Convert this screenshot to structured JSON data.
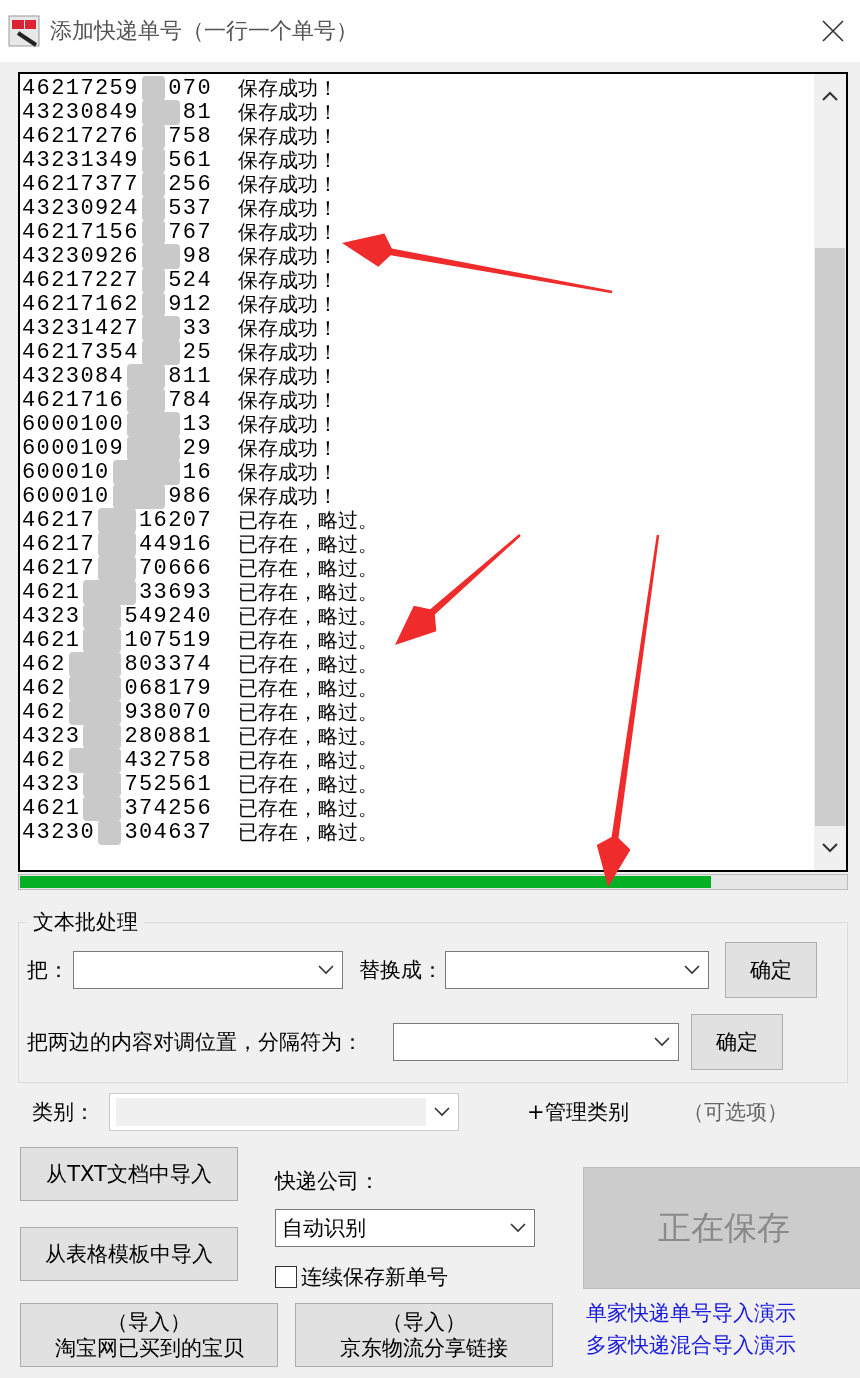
{
  "window": {
    "title": "添加快递单号（一行一个单号）"
  },
  "log": {
    "rows": [
      {
        "head": "46217259",
        "tail": "070",
        "status": "保存成功！"
      },
      {
        "head": "43230849",
        "tail": "81",
        "status": "保存成功！"
      },
      {
        "head": "46217276",
        "tail": "758",
        "status": "保存成功！"
      },
      {
        "head": "43231349",
        "tail": "561",
        "status": "保存成功！"
      },
      {
        "head": "46217377",
        "tail": "256",
        "status": "保存成功！"
      },
      {
        "head": "43230924",
        "tail": "537",
        "status": "保存成功！"
      },
      {
        "head": "46217156",
        "tail": "767",
        "status": "保存成功！"
      },
      {
        "head": "43230926",
        "tail": "98",
        "status": "保存成功！"
      },
      {
        "head": "46217227",
        "tail": "524",
        "status": "保存成功！"
      },
      {
        "head": "46217162",
        "tail": "912",
        "status": "保存成功！"
      },
      {
        "head": "43231427",
        "tail": "33",
        "status": "保存成功！"
      },
      {
        "head": "46217354",
        "tail": "25",
        "status": "保存成功！"
      },
      {
        "head": "4323084",
        "tail": "811",
        "status": "保存成功！"
      },
      {
        "head": "4621716",
        "tail": "784",
        "status": "保存成功！"
      },
      {
        "head": "6000100",
        "tail": "13",
        "status": "保存成功！"
      },
      {
        "head": "6000109",
        "tail": "29",
        "status": "保存成功！"
      },
      {
        "head": "600010",
        "tail": "16",
        "status": "保存成功！"
      },
      {
        "head": "600010",
        "tail": "986",
        "status": "保存成功！"
      },
      {
        "head": "46217",
        "tail": "16207",
        "status": "已存在，略过。"
      },
      {
        "head": "46217",
        "tail": "44916",
        "status": "已存在，略过。"
      },
      {
        "head": "46217",
        "tail": "70666",
        "status": "已存在，略过。"
      },
      {
        "head": "4621",
        "tail": "33693",
        "status": "已存在，略过。"
      },
      {
        "head": "4323",
        "tail": "549240",
        "status": "已存在，略过。"
      },
      {
        "head": "4621",
        "tail": "107519",
        "status": "已存在，略过。"
      },
      {
        "head": "462",
        "tail": "803374",
        "status": "已存在，略过。"
      },
      {
        "head": "462",
        "tail": "068179",
        "status": "已存在，略过。"
      },
      {
        "head": "462",
        "tail": "938070",
        "status": "已存在，略过。"
      },
      {
        "head": "4323",
        "tail": "280881",
        "status": "已存在，略过。"
      },
      {
        "head": "462",
        "tail": "432758",
        "status": "已存在，略过。"
      },
      {
        "head": "4323",
        "tail": "752561",
        "status": "已存在，略过。"
      },
      {
        "head": "4621",
        "tail": "374256",
        "status": "已存在，略过。"
      },
      {
        "head": "43230",
        "tail": "304637",
        "status": "已存在，略过。"
      }
    ]
  },
  "progress": {
    "level": 0.837
  },
  "batch": {
    "title": "文本批处理",
    "replace_label": "把：",
    "with_label": "替换成：",
    "replace_button": "确定",
    "swap_label": "把两边的内容对调位置，分隔符为：",
    "swap_button": "确定"
  },
  "category": {
    "label": "类别：",
    "disabled": true,
    "manage_link": "+管理类别",
    "hint": "（可选项）"
  },
  "import_txt": "从TXT文档中导入",
  "import_sheet": "从表格模板中导入",
  "courier": {
    "label": "快递公司：",
    "value": "自动识别"
  },
  "continuous": {
    "label": "连续保存新单号",
    "checked": false
  },
  "save_button": {
    "label": "正在保存",
    "disabled": true
  },
  "import_buttons": [
    {
      "line1": "（导入）",
      "line2": "淘宝网已买到的宝贝"
    },
    {
      "line1": "（导入）",
      "line2": "京东物流分享链接"
    }
  ],
  "demo_links": [
    "单家快递单号导入演示",
    "多家快递混合导入演示"
  ]
}
